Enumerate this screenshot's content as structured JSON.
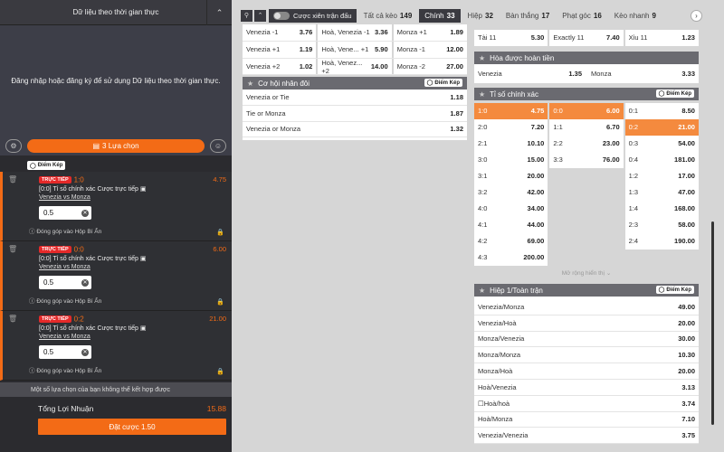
{
  "sidebar": {
    "header": "Dữ liệu theo thời gian thực",
    "login_msg": "Đăng nhập hoặc đăng ký để sử dụng Dữ liệu theo thời gian thực.",
    "selections_btn": "3 Lựa chọn",
    "tag": "Điểm Kép",
    "bets": [
      {
        "live": "TRỰC TIẾP",
        "score": "1:0",
        "odd": "4.75",
        "line": "[0:0] Tỉ số chính xác Cược trực tiếp",
        "match": "Venezia vs Monza",
        "stake": "0.5",
        "contrib": "Đóng góp vào Hộp Bí Ẩn"
      },
      {
        "live": "TRỰC TIẾP",
        "score": "0:0",
        "odd": "6.00",
        "line": "[0:0] Tỉ số chính xác Cược trực tiếp",
        "match": "Venezia vs Monza",
        "stake": "0.5",
        "contrib": "Đóng góp vào Hộp Bí Ẩn"
      },
      {
        "live": "TRỰC TIẾP",
        "score": "0:2",
        "odd": "21.00",
        "line": "[0:0] Tỉ số chính xác Cược trực tiếp",
        "match": "Venezia vs Monza",
        "stake": "0.5",
        "contrib": "Đóng góp vào Hộp Bí Ẩn"
      }
    ],
    "warning": "Một số lựa chọn của bạn không thể kết hợp được",
    "total_label": "Tổng Lợi Nhuận",
    "total_value": "15.88",
    "place_btn": "Đặt cược 1.50"
  },
  "topbar": {
    "combo_label": "Cược xiên trận đấu",
    "tabs": [
      {
        "label": "Tất cả kèo",
        "count": "149"
      },
      {
        "label": "Chính",
        "count": "33"
      },
      {
        "label": "Hiệp",
        "count": "32"
      },
      {
        "label": "Bàn thắng",
        "count": "17"
      },
      {
        "label": "Phạt góc",
        "count": "16"
      },
      {
        "label": "Kèo nhanh",
        "count": "9"
      }
    ]
  },
  "left": {
    "top_rows": [
      [
        {
          "l": "Venezia -1",
          "o": "3.76"
        },
        {
          "l": "Hoà, Venezia -1",
          "o": "3.36"
        },
        {
          "l": "Monza +1",
          "o": "1.89"
        }
      ],
      [
        {
          "l": "Venezia +1",
          "o": "1.19"
        },
        {
          "l": "Hoà, Vene...   +1",
          "o": "5.90"
        },
        {
          "l": "Monza -1",
          "o": "12.00"
        }
      ],
      [
        {
          "l": "Venezia +2",
          "o": "1.02"
        },
        {
          "l": "Hoà, Venez...   +2",
          "o": "14.00"
        },
        {
          "l": "Monza -2",
          "o": "27.00"
        }
      ]
    ],
    "dc_title": "Cơ hội nhân đôi",
    "dc_rows": [
      {
        "l": "Venezia or Tie",
        "o": "1.18"
      },
      {
        "l": "Tie or Monza",
        "o": "1.87"
      },
      {
        "l": "Venezia or Monza",
        "o": "1.32"
      }
    ]
  },
  "right": {
    "top_row": [
      {
        "l": "Tài 11",
        "o": "5.30"
      },
      {
        "l": "Exactly 11",
        "o": "7.40"
      },
      {
        "l": "Xỉu 11",
        "o": "1.23"
      }
    ],
    "dnb_title": "Hòa được hoàn tiền",
    "dnb_row": [
      {
        "l": "Venezia",
        "o": "1.35"
      },
      {
        "l": "Monza",
        "o": "3.33"
      }
    ],
    "cs_title": "Tỉ số chính xác",
    "cs_rows": [
      [
        {
          "l": "1:0",
          "o": "4.75",
          "s": 1
        },
        {
          "l": "0:0",
          "o": "6.00",
          "s": 1
        },
        {
          "l": "0:1",
          "o": "8.50"
        }
      ],
      [
        {
          "l": "2:0",
          "o": "7.20"
        },
        {
          "l": "1:1",
          "o": "6.70"
        },
        {
          "l": "0:2",
          "o": "21.00",
          "s": 1
        }
      ],
      [
        {
          "l": "2:1",
          "o": "10.10"
        },
        {
          "l": "2:2",
          "o": "23.00"
        },
        {
          "l": "0:3",
          "o": "54.00"
        }
      ],
      [
        {
          "l": "3:0",
          "o": "15.00"
        },
        {
          "l": "3:3",
          "o": "76.00"
        },
        {
          "l": "0:4",
          "o": "181.00"
        }
      ],
      [
        {
          "l": "3:1",
          "o": "20.00"
        },
        null,
        {
          "l": "1:2",
          "o": "17.00"
        }
      ],
      [
        {
          "l": "3:2",
          "o": "42.00"
        },
        null,
        {
          "l": "1:3",
          "o": "47.00"
        }
      ],
      [
        {
          "l": "4:0",
          "o": "34.00"
        },
        null,
        {
          "l": "1:4",
          "o": "168.00"
        }
      ],
      [
        {
          "l": "4:1",
          "o": "44.00"
        },
        null,
        {
          "l": "2:3",
          "o": "58.00"
        }
      ],
      [
        {
          "l": "4:2",
          "o": "69.00"
        },
        null,
        {
          "l": "2:4",
          "o": "190.00"
        }
      ],
      [
        {
          "l": "4:3",
          "o": "200.00"
        },
        null,
        null
      ]
    ],
    "more": "Mở rộng hiển thị",
    "htft_title": "Hiệp 1/Toàn trận",
    "htft_rows": [
      {
        "l": "Venezia/Monza",
        "o": "49.00"
      },
      {
        "l": "Venezia/Hoà",
        "o": "20.00"
      },
      {
        "l": "Monza/Venezia",
        "o": "30.00"
      },
      {
        "l": "Monza/Monza",
        "o": "10.30"
      },
      {
        "l": "Monza/Hoà",
        "o": "20.00"
      },
      {
        "l": "Hoà/Venezia",
        "o": "3.13"
      },
      {
        "l": "☐Hoà/hoà",
        "o": "3.74"
      },
      {
        "l": "Hoà/Monza",
        "o": "7.10"
      },
      {
        "l": "Venezia/Venezia",
        "o": "3.75"
      }
    ]
  }
}
